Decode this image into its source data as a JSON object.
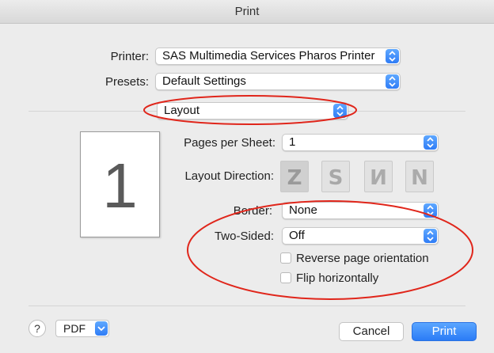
{
  "window": {
    "title": "Print"
  },
  "printer": {
    "label": "Printer:",
    "value": "SAS Multimedia Services Pharos Printer"
  },
  "presets": {
    "label": "Presets:",
    "value": "Default Settings"
  },
  "section": {
    "value": "Layout"
  },
  "layout": {
    "pages_label": "Pages per Sheet:",
    "pages_value": "1",
    "direction_label": "Layout Direction:",
    "direction_options": [
      "Z",
      "S",
      "N-reverse",
      "N"
    ],
    "border_label": "Border:",
    "border_value": "None",
    "two_sided_label": "Two-Sided:",
    "two_sided_value": "Off",
    "reverse_label": "Reverse page orientation",
    "flip_label": "Flip horizontally",
    "preview_page": "1"
  },
  "footer": {
    "help": "?",
    "pdf": "PDF",
    "cancel": "Cancel",
    "print": "Print"
  },
  "colors": {
    "accent": "#2f7cf6",
    "annotation": "#e0261b"
  }
}
